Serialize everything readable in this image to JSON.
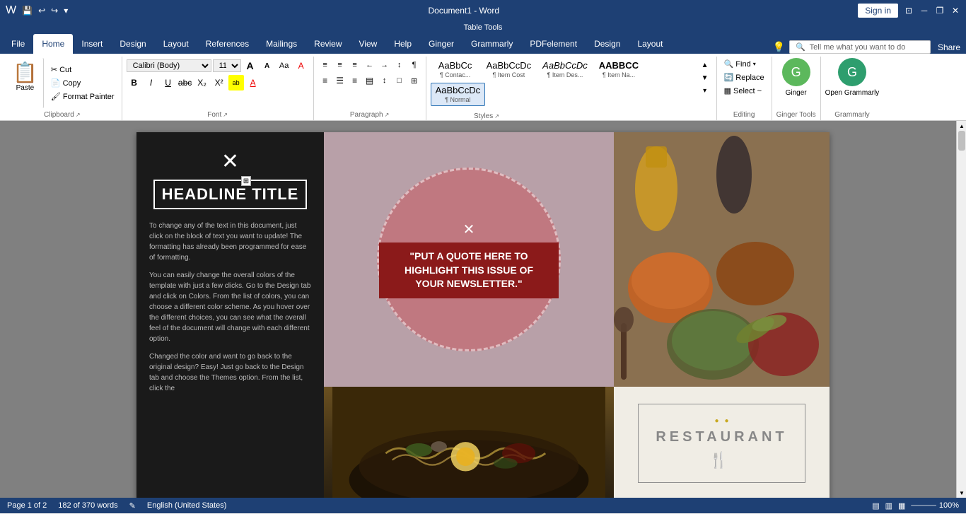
{
  "titlebar": {
    "title": "Document1 - Word",
    "table_tools": "Table Tools",
    "save_icon": "💾",
    "undo_icon": "↩",
    "redo_icon": "↪",
    "customize_icon": "▾",
    "minimize_icon": "─",
    "restore_icon": "❐",
    "close_icon": "✕",
    "signin_label": "Sign in"
  },
  "ribbon_tabs": {
    "file": "File",
    "home": "Home",
    "insert": "Insert",
    "design": "Design",
    "layout": "Layout",
    "references": "References",
    "mailings": "Mailings",
    "review": "Review",
    "view": "View",
    "help": "Help",
    "ginger": "Ginger",
    "grammarly": "Grammarly",
    "pdfelement": "PDFelement",
    "design2": "Design",
    "layout2": "Layout",
    "light_icon": "💡",
    "tell_me": "Tell me what you want to do",
    "share": "Share"
  },
  "clipboard": {
    "label": "Clipboard",
    "paste_icon": "📋",
    "paste_label": "Paste",
    "cut_label": "Cut",
    "cut_icon": "✂",
    "copy_label": "Copy",
    "copy_icon": "📄",
    "format_painter_label": "Format Painter",
    "format_painter_icon": "🖌",
    "expand_icon": "↗"
  },
  "font": {
    "label": "Font",
    "family": "Calibri (Body)",
    "size": "11",
    "grow_icon": "A",
    "shrink_icon": "A",
    "case_icon": "Aa",
    "clear_icon": "A",
    "bold": "B",
    "italic": "I",
    "underline": "U",
    "strikethrough": "abc",
    "subscript": "X₂",
    "superscript": "X²",
    "text_color": "A",
    "highlight": "ab",
    "font_color_btn": "A",
    "expand_icon": "↗"
  },
  "paragraph": {
    "label": "Paragraph",
    "bullets_icon": "≡",
    "numbering_icon": "≡",
    "multilevel_icon": "≡",
    "decrease_indent": "←",
    "increase_indent": "→",
    "sort_icon": "↕",
    "show_para": "¶",
    "align_left": "≡",
    "align_center": "≡",
    "align_right": "≡",
    "justify": "≡",
    "line_spacing": "↕",
    "shading": "□",
    "borders": "⊞",
    "expand_icon": "↗"
  },
  "styles": {
    "label": "Styles",
    "items": [
      {
        "name": "Contact",
        "preview": "AaBbCc",
        "desc": "¶ Contac..."
      },
      {
        "name": "ItemCost",
        "preview": "AaBbCcDc",
        "desc": "¶ Item Cost"
      },
      {
        "name": "ItemDesc",
        "preview": "AaBbCcDc",
        "desc": "¶ Item Des..."
      },
      {
        "name": "ItemName",
        "preview": "AABBCC",
        "desc": "¶ Item Na..."
      },
      {
        "name": "Normal",
        "preview": "AaBbCcDc",
        "desc": "¶ Normal"
      }
    ],
    "scroll_up": "▲",
    "scroll_down": "▼",
    "expand": "▾",
    "expand_icon": "↗"
  },
  "editing": {
    "label": "Editing",
    "find_label": "Find",
    "find_icon": "🔍",
    "replace_label": "Replace",
    "replace_icon": "🔄",
    "select_label": "Select ~",
    "select_icon": "▦"
  },
  "ginger_tools": {
    "label": "Ginger Tools",
    "ginger_label": "Ginger",
    "open_grammarly": "Open Grammarly"
  },
  "grammarly": {
    "label": "Grammarly"
  },
  "document": {
    "headline": "HEADLINE TITLE",
    "quote": "\"PUT A QUOTE HERE TO HIGHLIGHT THIS ISSUE OF YOUR NEWSLETTER.\"",
    "restaurant_name": "RESTAURANT",
    "body_para1": "To change any of the text in this document, just click on the block of text you want to update!  The formatting has already been programmed for ease of formatting.",
    "body_para2": "You can easily change the overall colors of the template with just a few clicks.  Go to the Design tab and click on Colors.  From the list of colors, you can choose a different color scheme.  As you hover over the different choices, you can see what the overall feel of the document will change with each different option.",
    "body_para3": "Changed the color and want to go back to the original design?  Easy!  Just go back to the Design tab and choose the Themes option.  From the list, click the"
  },
  "statusbar": {
    "page_info": "Page 1 of 2",
    "words": "182 of 370 words",
    "language": "English (United States)",
    "zoom": "100%",
    "edit_icon": "✎",
    "view_icons": [
      "▤",
      "▥",
      "▦"
    ]
  }
}
